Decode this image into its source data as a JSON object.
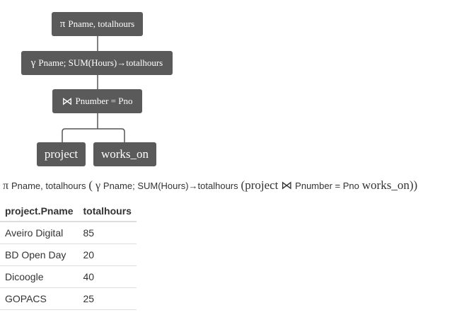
{
  "tree": {
    "projection": {
      "symbol": "π",
      "text": "Pname, totalhours"
    },
    "grouping": {
      "symbol": "γ",
      "text": "Pname; SUM(Hours)→totalhours"
    },
    "join": {
      "symbol": "⋈",
      "text": "Pnumber = Pno"
    },
    "leaves": [
      "project",
      "works_on"
    ]
  },
  "expression": {
    "projection_symbol": "π",
    "projection_attrs": "Pname, totalhours",
    "open_paren": "(",
    "grouping_symbol": "γ",
    "grouping_attrs": "Pname; SUM(Hours)→totalhours",
    "inner_open": "(project",
    "join_symbol": "⋈",
    "join_condition": "Pnumber = Pno",
    "inner_close": "works_on))"
  },
  "table": {
    "columns": [
      "project.Pname",
      "totalhours"
    ],
    "rows": [
      [
        "Aveiro Digital",
        "85"
      ],
      [
        "BD Open Day",
        "20"
      ],
      [
        "Dicoogle",
        "40"
      ],
      [
        "GOPACS",
        "25"
      ]
    ]
  }
}
